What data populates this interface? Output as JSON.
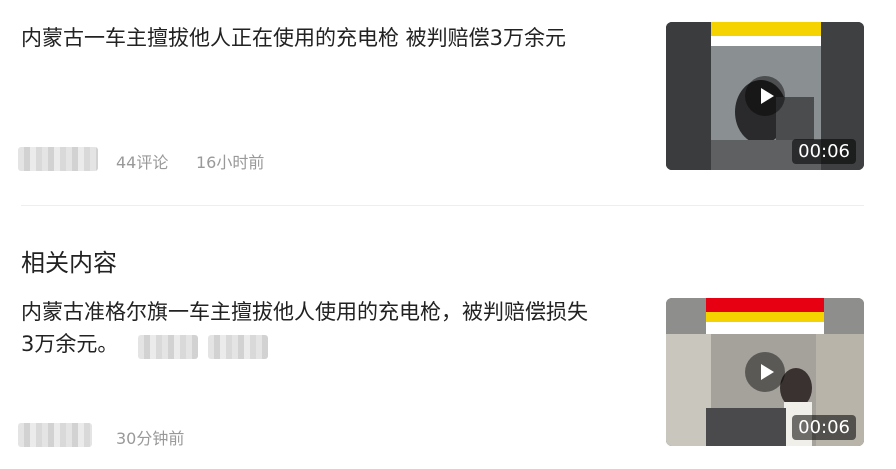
{
  "article1": {
    "title": "内蒙古一车主擅拔他人正在使用的充电枪 被判赔偿3万余元",
    "comments": "44评论",
    "time": "16小时前",
    "duration": "00:06"
  },
  "section_title": "相关内容",
  "article2": {
    "title_line1": "内蒙古准格尔旗一车主擅拔他人使用的充电枪，被判赔偿损失",
    "title_line2": "3万余元。",
    "time": "30分钟前",
    "duration": "00:06"
  },
  "colors": {
    "accent_yellow": "#f5d300",
    "caption_red": "#e60012"
  }
}
